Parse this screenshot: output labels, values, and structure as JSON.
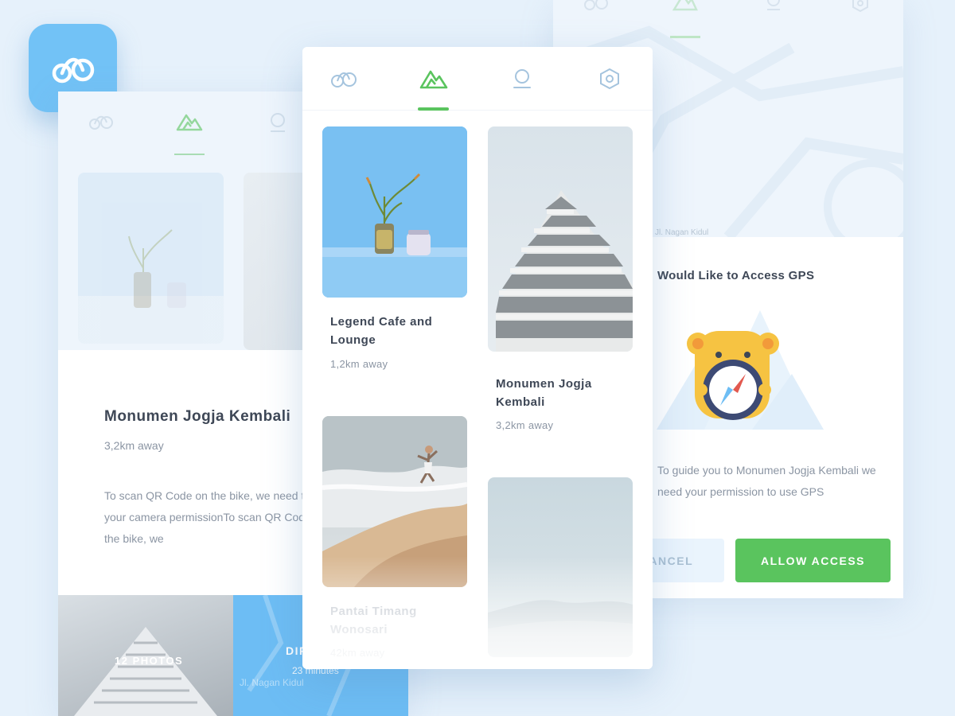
{
  "app": {
    "icon": "bike-icon",
    "color": "#72c2f6"
  },
  "tabs": [
    {
      "icon": "bike-icon",
      "active": false
    },
    {
      "icon": "mountain-icon",
      "active": true
    },
    {
      "icon": "location-pin-icon",
      "active": false
    },
    {
      "icon": "settings-icon",
      "active": false
    }
  ],
  "accent": {
    "green": "#5ac45e",
    "blue": "#6dbdf4"
  },
  "left_card": {
    "title": "Monumen Jogja Kembali",
    "distance": "3,2km away",
    "description": "To scan QR Code on the bike, we need to get your camera permissionTo scan QR Code on the bike, we",
    "photos_label": "12 PHOTOS",
    "directions_label": "DIRECTIONS",
    "directions_time": "23 minutes",
    "directions_street": "Jl. Nagan Kidul"
  },
  "right_card": {
    "map_street": "Jl. Nagan Kidul",
    "title": "Would Like to Access GPS",
    "description": "To guide you to Monumen Jogja Kembali we need your permission to use GPS",
    "cancel_label": "CANCEL",
    "allow_label": "ALLOW ACCESS"
  },
  "places": [
    {
      "name": "Legend Cafe and Lounge",
      "distance": "1,2km away"
    },
    {
      "name": "Monumen Jogja Kembali",
      "distance": "3,2km away"
    },
    {
      "name": "Pantai Timang Wonosari",
      "distance": "42km away"
    },
    {
      "name": "",
      "distance": ""
    }
  ]
}
